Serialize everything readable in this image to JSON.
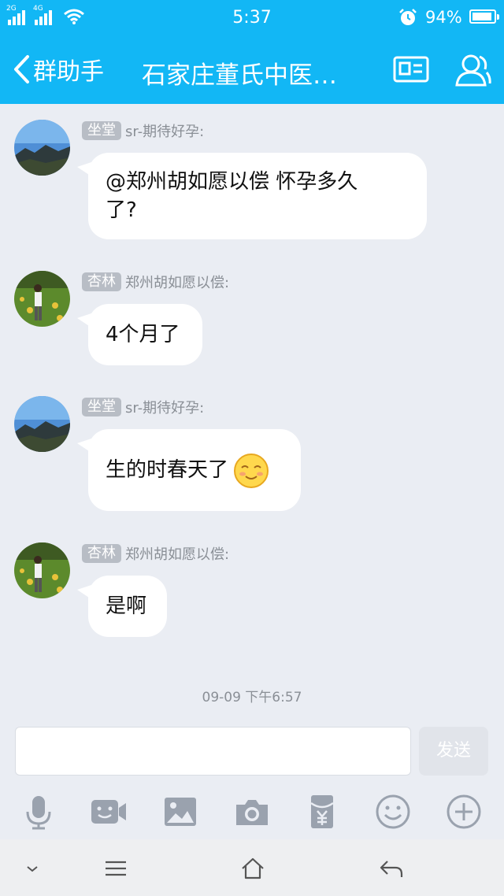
{
  "status_bar": {
    "signal_1_label": "2G",
    "signal_2_label": "4G",
    "time": "5:37",
    "battery_percent": "94%",
    "battery_level": 0.94
  },
  "nav": {
    "back_label": "群助手",
    "title": "石家庄董氏中医…"
  },
  "messages": [
    {
      "badge": "坐堂",
      "sender": "sr-期待好孕:",
      "text_lines": [
        "@郑州胡如愿以偿 怀孕多久",
        "了?"
      ]
    },
    {
      "badge": "杏林",
      "sender": "郑州胡如愿以偿:",
      "text": "4个月了"
    },
    {
      "badge": "坐堂",
      "sender": "sr-期待好孕:",
      "text": "生的时春天了",
      "emoji": "smiling-face-icon"
    },
    {
      "badge": "杏林",
      "sender": "郑州胡如愿以偿:",
      "text": "是啊"
    }
  ],
  "timestamp": "09-09 下午6:57",
  "composer": {
    "send_label": "发送",
    "value": ""
  },
  "toolbar": [
    "microphone-icon",
    "video-icon",
    "image-icon",
    "camera-icon",
    "red-packet-icon",
    "emoji-icon",
    "plus-icon"
  ],
  "colors": {
    "accent": "#12b7f5",
    "background": "#eaedf3",
    "badge": "#b8bdc5"
  }
}
